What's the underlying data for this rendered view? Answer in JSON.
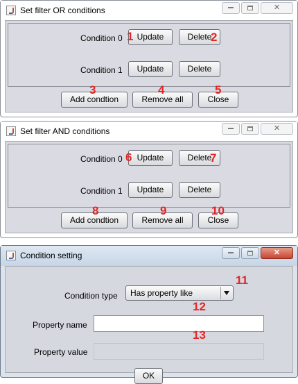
{
  "windows": {
    "or": {
      "title": "Set filter OR conditions",
      "conditions": [
        {
          "label": "Condition 0",
          "update": "Update",
          "delete": "Delete"
        },
        {
          "label": "Condition 1",
          "update": "Update",
          "delete": "Delete"
        }
      ],
      "add_label": "Add condtion",
      "remove_all_label": "Remove all",
      "close_label": "Close"
    },
    "and": {
      "title": "Set filter AND conditions",
      "conditions": [
        {
          "label": "Condition 0",
          "update": "Update",
          "delete": "Delete"
        },
        {
          "label": "Condition 1",
          "update": "Update",
          "delete": "Delete"
        }
      ],
      "add_label": "Add condtion",
      "remove_all_label": "Remove all",
      "close_label": "Close"
    },
    "setting": {
      "title": "Condition setting",
      "condition_type_label": "Condition type",
      "condition_type_value": "Has property like",
      "property_name_label": "Property name",
      "property_name_value": "",
      "property_value_label": "Property value",
      "property_value_value": "",
      "ok_label": "OK"
    }
  },
  "annotations": [
    "1",
    "2",
    "3",
    "4",
    "5",
    "6",
    "7",
    "8",
    "9",
    "10",
    "11",
    "12",
    "13"
  ],
  "icons": {
    "app": "java-cup-icon",
    "minimize": "minimize-icon",
    "maximize": "maximize-icon",
    "close": "close-icon"
  },
  "colors": {
    "annotation": "#e32626",
    "client_bg": "#dadbe2",
    "close_button_active": "#c64531"
  }
}
